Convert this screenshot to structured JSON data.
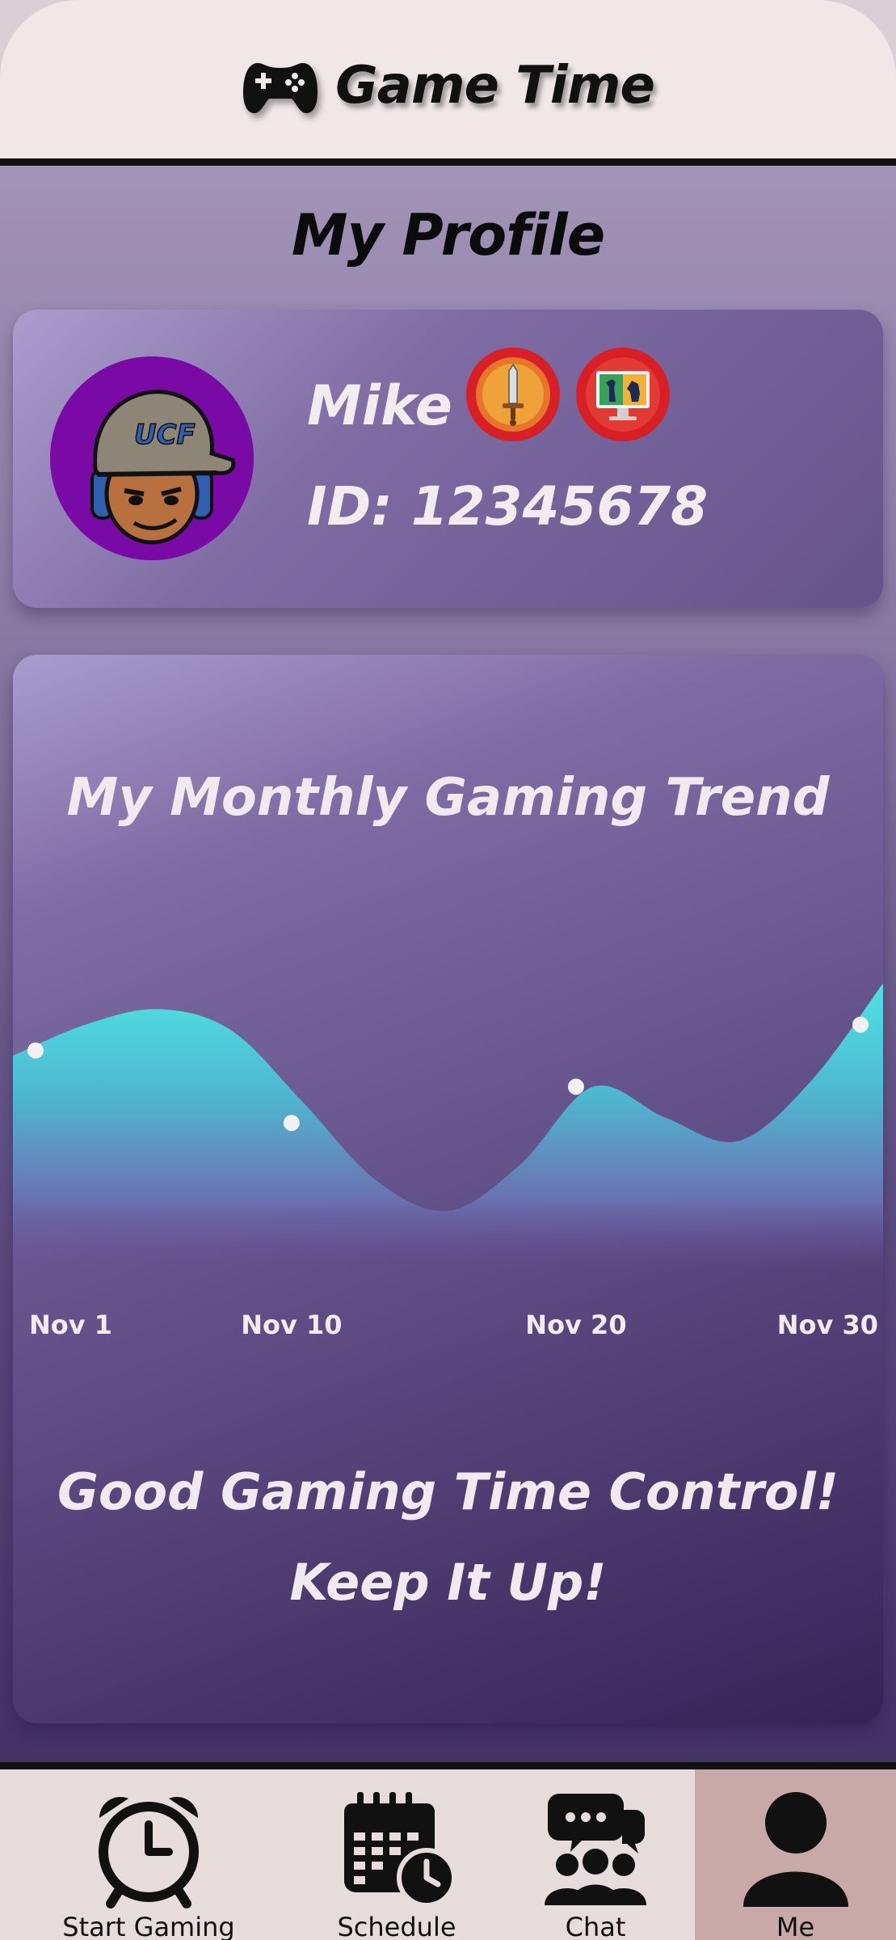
{
  "header": {
    "app_title": "Game Time",
    "icon": "gamepad-icon"
  },
  "page": {
    "title": "My Profile"
  },
  "profile": {
    "name": "Mike",
    "id_text": "ID: 12345678",
    "avatar_text": "UCF",
    "badges": [
      "sword-badge-icon",
      "chess-badge-icon"
    ]
  },
  "trend": {
    "title": "My Monthly Gaming Trend",
    "message_line1": "Good Gaming Time Control!",
    "message_line2": "Keep It Up!"
  },
  "chart_data": {
    "type": "area",
    "title": "My Monthly Gaming Trend",
    "x_ticks": [
      "Nov 1",
      "Nov 10",
      "Nov 20",
      "Nov 30"
    ],
    "marked_points": [
      {
        "x": "Nov 1",
        "y": 0.72
      },
      {
        "x": "Nov 10",
        "y": 0.44
      },
      {
        "x": "Nov 20",
        "y": 0.58
      },
      {
        "x": "Nov 30",
        "y": 0.82
      }
    ],
    "curve_profile": [
      0.7,
      0.82,
      0.88,
      0.8,
      0.52,
      0.22,
      0.1,
      0.28,
      0.58,
      0.46,
      0.37,
      0.6,
      0.98
    ],
    "colors": {
      "fill_top": "#4fe2e4",
      "fill_bottom": "#7f5aa8",
      "marker": "#f2f0f2"
    },
    "grid": false,
    "legend": "none"
  },
  "tabs": [
    {
      "label": "Start Gaming",
      "icon": "alarm-clock-icon",
      "active": false
    },
    {
      "label": "Schedule",
      "icon": "calendar-clock-icon",
      "active": false
    },
    {
      "label": "Chat",
      "icon": "group-chat-icon",
      "active": false
    },
    {
      "label": "Me",
      "icon": "person-icon",
      "active": true
    }
  ]
}
